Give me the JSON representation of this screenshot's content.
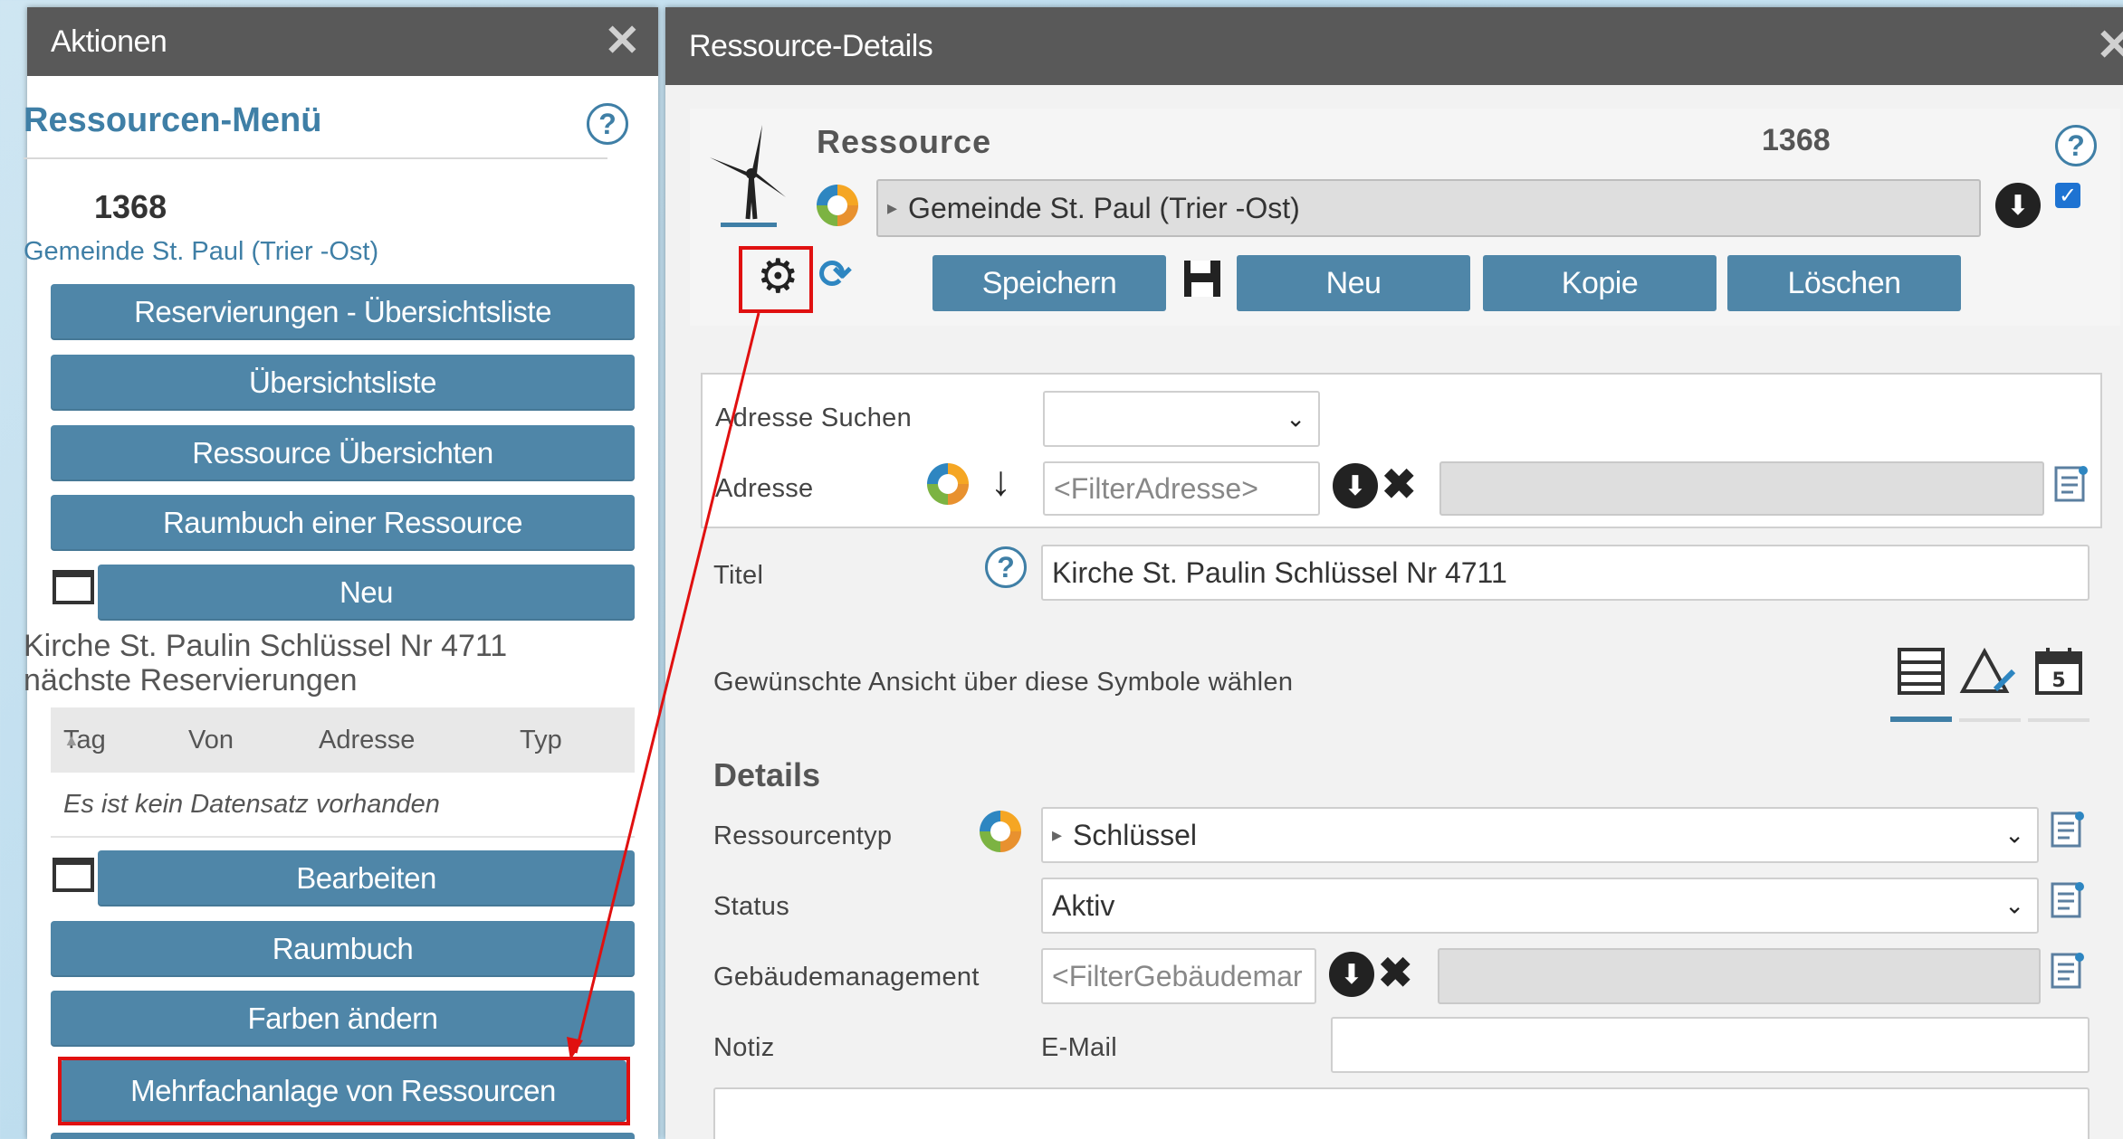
{
  "left_panel": {
    "header_title": "Aktionen",
    "menu_title": "Ressourcen-Menü",
    "resource_id": "1368",
    "organization": "Gemeinde St. Paul (Trier -Ost)",
    "buttons": [
      "Reservierungen - Übersichtsliste",
      "Übersichtsliste",
      "Ressource Übersichten",
      "Raumbuch einer Ressource",
      "Neu"
    ],
    "item_title": "Kirche St. Paulin Schlüssel Nr 4711",
    "item_subtitle": "nächste Reservierungen",
    "table": {
      "columns": [
        "Tag",
        "Von",
        "Adresse",
        "Typ"
      ],
      "empty_text": "Es ist kein Datensatz vorhanden"
    },
    "buttons_bottom": [
      "Bearbeiten",
      "Raumbuch",
      "Farben ändern",
      "Mehrfachanlage von Ressourcen"
    ]
  },
  "right_panel": {
    "header_title": "Ressource-Details",
    "resource_label": "Ressource",
    "resource_id": "1368",
    "organization_value": "Gemeinde St. Paul (Trier -Ost)",
    "toolbar": {
      "save": "Speichern",
      "new": "Neu",
      "copy": "Kopie",
      "delete": "Löschen"
    },
    "form": {
      "address_search_label": "Adresse Suchen",
      "address_search_value": "",
      "address_label": "Adresse",
      "address_filter_placeholder": "<FilterAdresse>",
      "title_label": "Titel",
      "title_value": "Kirche St. Paulin Schlüssel Nr 4711",
      "view_hint": "Gewünschte Ansicht über diese Symbole wählen",
      "details_heading": "Details",
      "resource_type_label": "Ressourcentyp",
      "resource_type_value": "Schlüssel",
      "status_label": "Status",
      "status_value": "Aktiv",
      "building_label": "Gebäudemanagement",
      "building_placeholder": "<FilterGebäudemar",
      "note_label": "Notiz",
      "email_label": "E-Mail",
      "email_value": ""
    }
  },
  "colors": {
    "button_blue": "#4f86a8",
    "header_gray": "#595959",
    "link_blue": "#3f7fa6",
    "highlight_red": "#e01010"
  }
}
